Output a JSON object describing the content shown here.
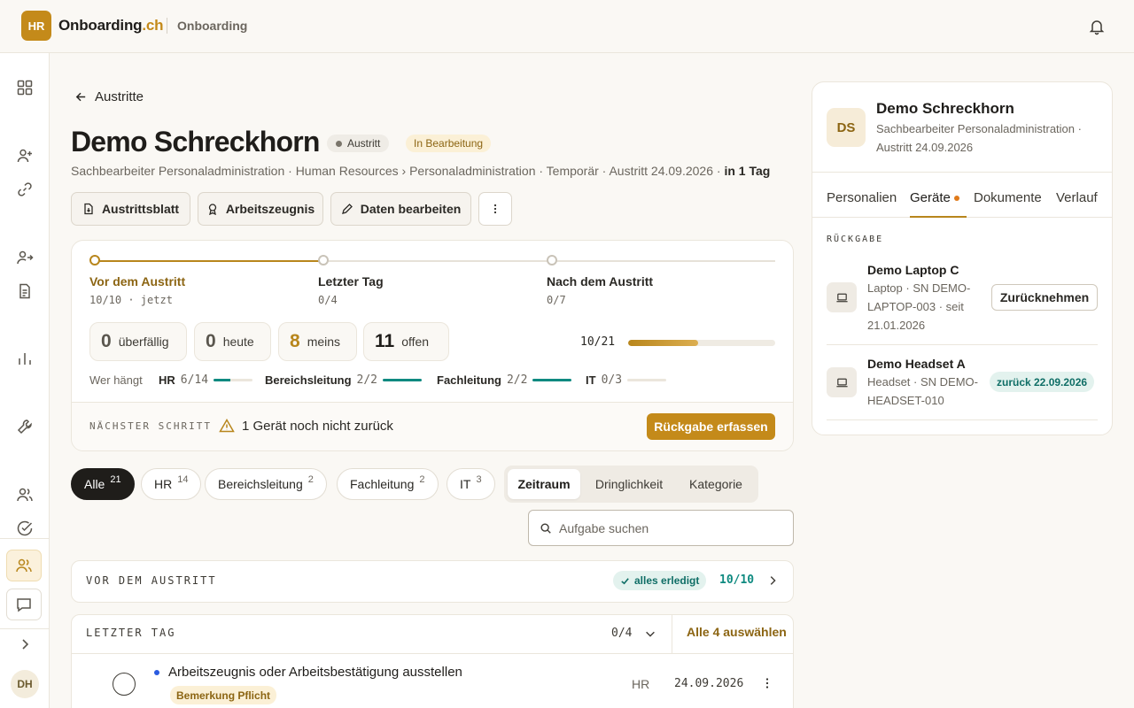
{
  "topbar": {
    "logo": "HR",
    "brand_name": "Onboarding",
    "brand_tld": ".ch",
    "section": "Onboarding"
  },
  "rail": {
    "user_initials": "DH"
  },
  "back_label": "Austritte",
  "person": {
    "name": "Demo Schreckhorn",
    "status_badge": "Austritt",
    "progress_badge": "In Bearbeitung",
    "subline": "Sachbearbeiter Personaladministration · Human Resources › Personaladministration · Temporär · Austritt 24.09.2026 · ",
    "subline_bold": "in 1 Tag"
  },
  "actions": {
    "austrittsblatt": "Austrittsblatt",
    "arbeitszeugnis": "Arbeitszeugnis",
    "edit": "Daten bearbeiten"
  },
  "phases": [
    {
      "label": "Vor dem Austritt",
      "sub": "10/10 · jetzt"
    },
    {
      "label": "Letzter Tag",
      "sub": "0/4"
    },
    {
      "label": "Nach dem Austritt",
      "sub": "0/7"
    }
  ],
  "stats": [
    {
      "num": "0",
      "label": "überfällig"
    },
    {
      "num": "0",
      "label": "heute"
    },
    {
      "num": "8",
      "label": "meins"
    },
    {
      "num": "11",
      "label": "offen"
    }
  ],
  "overall": {
    "text": "10/21",
    "done": 10,
    "total": 21
  },
  "who": {
    "label": "Wer hängt",
    "items": [
      {
        "name": "HR",
        "count": "6/14",
        "fraction": 0.43
      },
      {
        "name": "Bereichsleitung",
        "count": "2/2",
        "fraction": 1
      },
      {
        "name": "Fachleitung",
        "count": "2/2",
        "fraction": 1
      },
      {
        "name": "IT",
        "count": "0/3",
        "fraction": 0
      }
    ]
  },
  "next_step": {
    "label": "NÄCHSTER SCHRITT",
    "text": "1 Gerät noch nicht zurück",
    "button": "Rückgabe erfassen"
  },
  "filters": [
    {
      "label": "Alle",
      "count": "21"
    },
    {
      "label": "HR",
      "count": "14"
    },
    {
      "label": "Bereichsleitung",
      "count": "2"
    },
    {
      "label": "Fachleitung",
      "count": "2"
    },
    {
      "label": "IT",
      "count": "3"
    }
  ],
  "segments": [
    "Zeitraum",
    "Dringlichkeit",
    "Kategorie"
  ],
  "search": {
    "placeholder": "Aufgabe suchen"
  },
  "sections": {
    "before": {
      "title": "VOR DEM AUSTRITT",
      "pill": "alles erledigt",
      "count": "10/10"
    },
    "lastday": {
      "title": "LETZTER TAG",
      "count": "0/4",
      "select_all": "Alle 4 auswählen"
    }
  },
  "task": {
    "title": "Arbeitszeugnis oder Arbeitsbestätigung ausstellen",
    "tag": "Bemerkung Pflicht",
    "owner": "HR",
    "date": "24.09.2026"
  },
  "panel": {
    "initials": "DS",
    "name": "Demo Schreckhorn",
    "subtitle": "Sachbearbeiter Personaladministration · Austritt 24.09.2026",
    "tabs": [
      "Personalien",
      "Geräte",
      "Dokumente",
      "Verlauf"
    ],
    "section": "RÜCKGABE",
    "devices": [
      {
        "name": "Demo Laptop C",
        "meta": "Laptop · SN DEMO-LAPTOP-003 · seit 21.01.2026",
        "action": "Zurücknehmen"
      },
      {
        "name": "Demo Headset A",
        "meta": "Headset · SN DEMO-HEADSET-010",
        "status": "zurück 22.09.2026"
      }
    ]
  },
  "colors": {
    "accent": "#c48a1a",
    "teal": "#0f8a80",
    "dark": "#1f1d1a"
  }
}
